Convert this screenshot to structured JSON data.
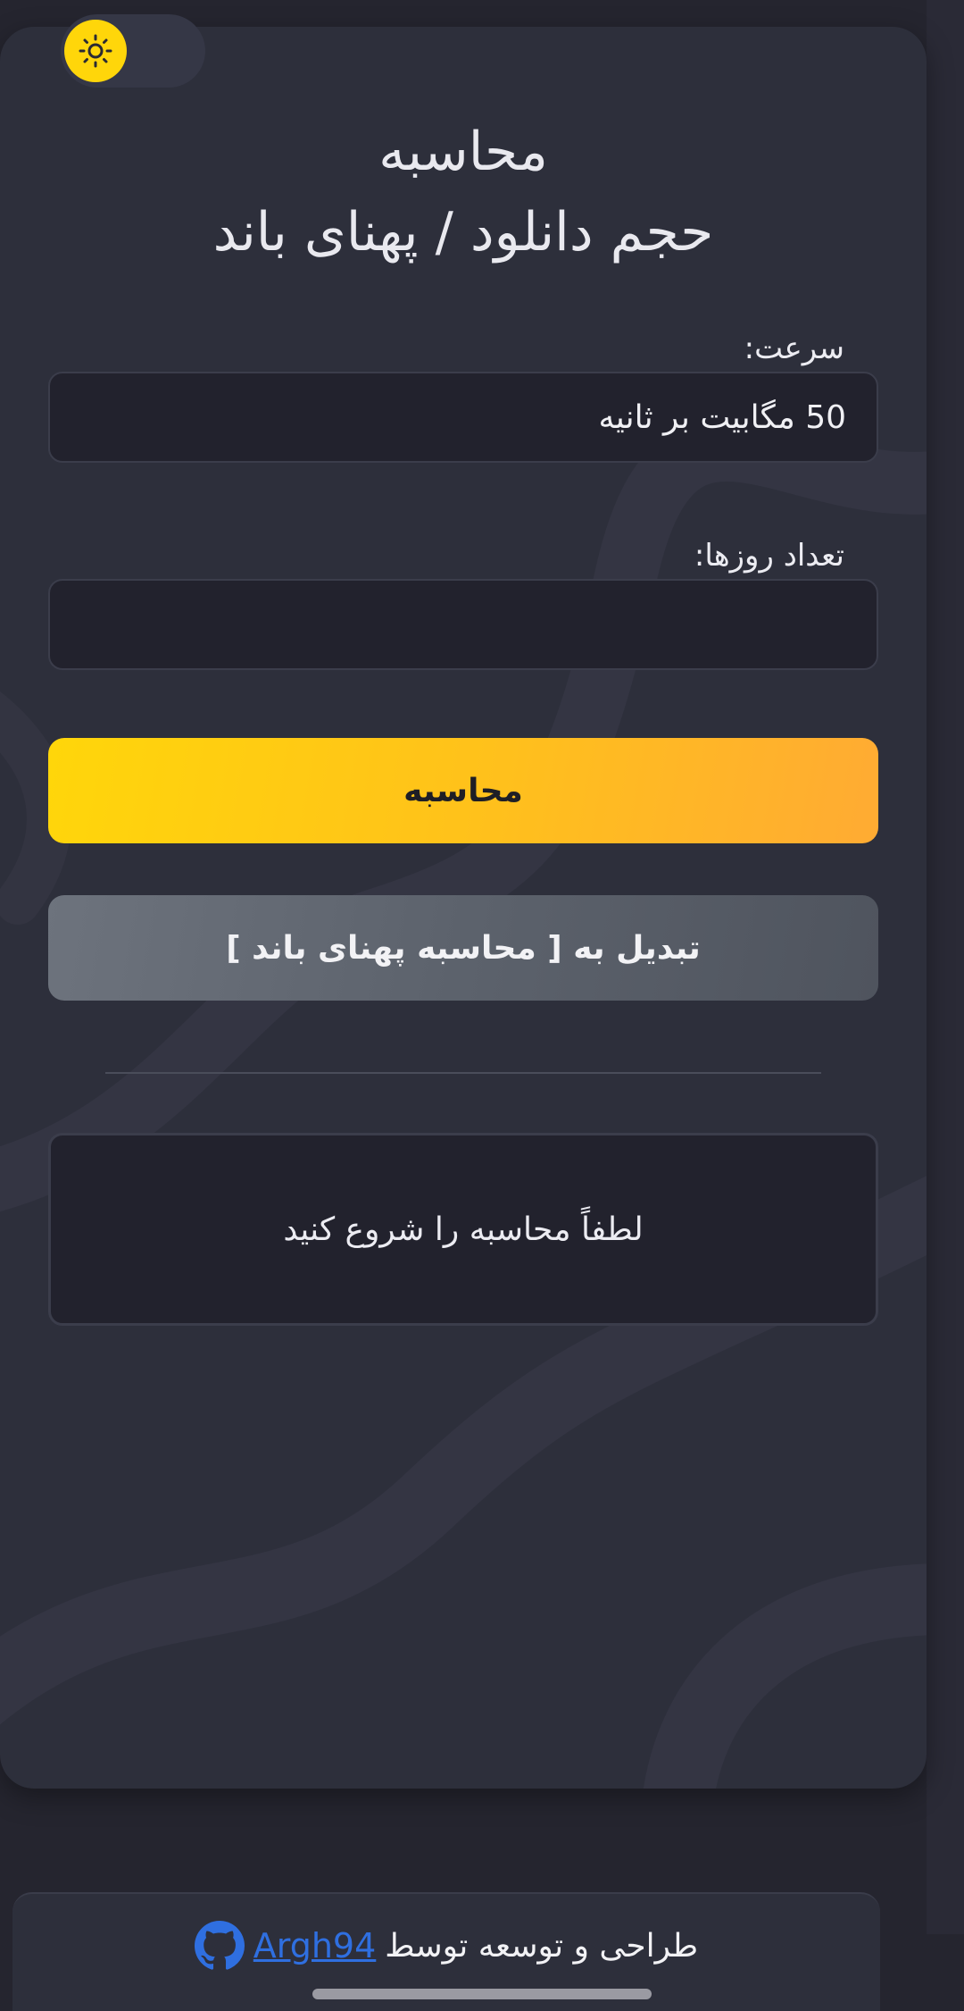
{
  "header": {
    "title_line1": "محاسبه",
    "title_line2": "حجم دانلود / پهنای باند"
  },
  "theme_toggle": {
    "icon": "sun-icon",
    "accent": "#ffd60a"
  },
  "form": {
    "speed_label": "سرعت:",
    "speed_value": "50 مگابیت بر ثانیه",
    "days_label": "تعداد روزها:",
    "days_value": ""
  },
  "buttons": {
    "calculate_label": "محاسبه",
    "switch_label": "تبدیل به [ محاسبه پهنای باند ]"
  },
  "result": {
    "text": "لطفاً محاسبه را شروع کنید"
  },
  "footer": {
    "credit_text": "طراحی و توسعه توسط",
    "author_link": "Argh94",
    "icon": "github-icon"
  },
  "colors": {
    "background": "#25252f",
    "card": "#2d2f3b",
    "primary_start": "#ffd60a",
    "primary_end": "#ffab33",
    "secondary": "#5c626c",
    "link": "#2f6fe0"
  }
}
